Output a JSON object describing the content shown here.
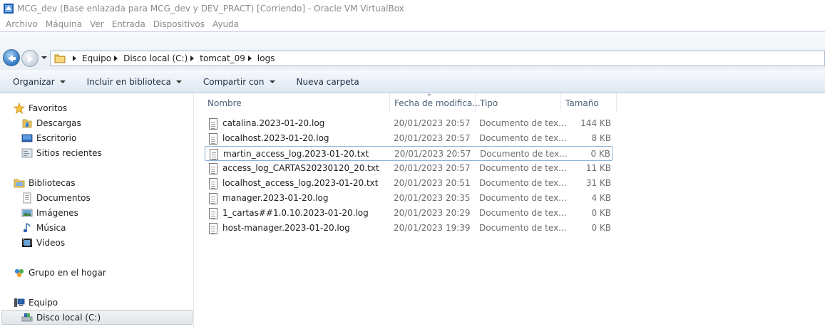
{
  "window": {
    "title": "MCG_dev (Base enlazada para MCG_dev y DEV_PRACT) [Corriendo] - Oracle VM VirtualBox",
    "menu": [
      "Archivo",
      "Máquina",
      "Ver",
      "Entrada",
      "Dispositivos",
      "Ayuda"
    ]
  },
  "address": {
    "crumbs": [
      "Equipo",
      "Disco local (C:)",
      "tomcat_09",
      "logs"
    ]
  },
  "commands": {
    "organize": "Organizar",
    "include": "Incluir en biblioteca",
    "share": "Compartir con",
    "new_folder": "Nueva carpeta"
  },
  "nav": {
    "favorites": "Favoritos",
    "downloads": "Descargas",
    "desktop": "Escritorio",
    "recent": "Sitios recientes",
    "libraries": "Bibliotecas",
    "documents": "Documentos",
    "images": "Imágenes",
    "music": "Música",
    "videos": "Vídeos",
    "homegroup": "Grupo en el hogar",
    "computer": "Equipo",
    "local_disk": "Disco local (C:)"
  },
  "columns": {
    "name": "Nombre",
    "date": "Fecha de modifica...",
    "type": "Tipo",
    "size": "Tamaño"
  },
  "files": [
    {
      "name": "catalina.2023-01-20.log",
      "date": "20/01/2023 20:57",
      "type": "Documento de tex...",
      "size": "144 KB"
    },
    {
      "name": "localhost.2023-01-20.log",
      "date": "20/01/2023 20:57",
      "type": "Documento de tex...",
      "size": "8 KB"
    },
    {
      "name": "martin_access_log.2023-01-20.txt",
      "date": "20/01/2023 20:57",
      "type": "Documento de tex...",
      "size": "0 KB"
    },
    {
      "name": "access_log_CARTAS20230120_20.txt",
      "date": "20/01/2023 20:57",
      "type": "Documento de tex...",
      "size": "11 KB"
    },
    {
      "name": "localhost_access_log.2023-01-20.txt",
      "date": "20/01/2023 20:51",
      "type": "Documento de tex...",
      "size": "31 KB"
    },
    {
      "name": "manager.2023-01-20.log",
      "date": "20/01/2023 20:35",
      "type": "Documento de tex...",
      "size": "4 KB"
    },
    {
      "name": "1_cartas##1.0.10.2023-01-20.log",
      "date": "20/01/2023 20:29",
      "type": "Documento de tex...",
      "size": "0 KB"
    },
    {
      "name": "host-manager.2023-01-20.log",
      "date": "20/01/2023 19:39",
      "type": "Documento de tex...",
      "size": "0 KB"
    }
  ]
}
